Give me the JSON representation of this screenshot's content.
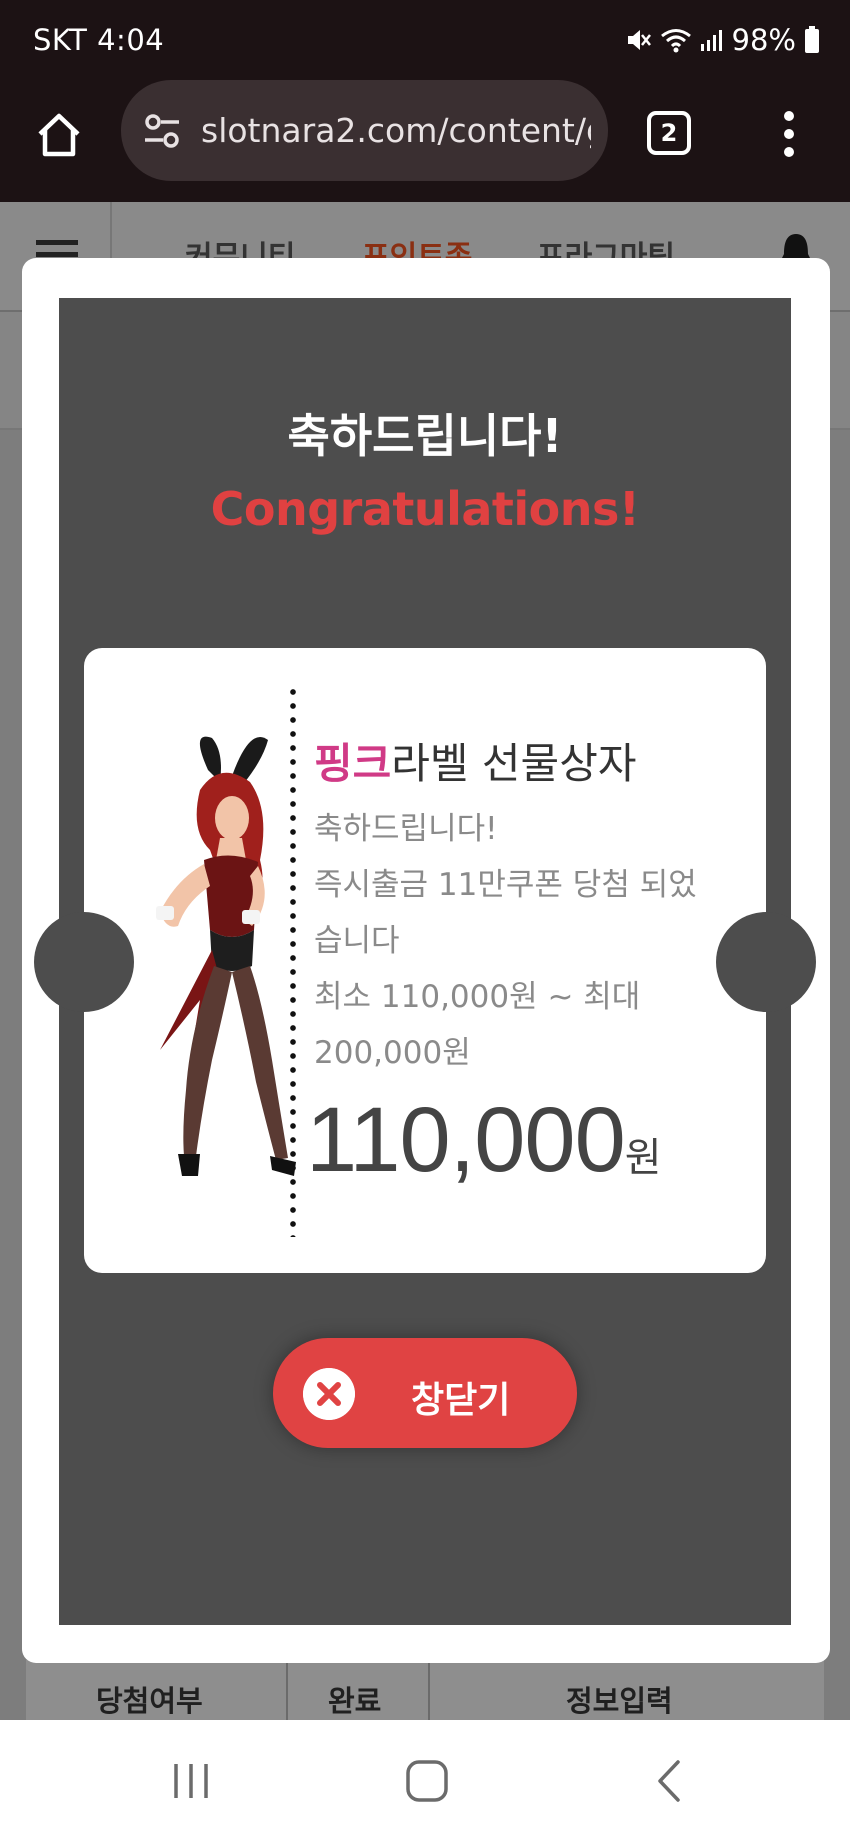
{
  "status_bar": {
    "carrier_time": "SKT 4:04",
    "battery": "98%"
  },
  "browser": {
    "url": "slotnara2.com/content/g",
    "tab_count": "2"
  },
  "page_background": {
    "nav_items": [
      "커뮤니티",
      "포인트존",
      "프라그마틱"
    ],
    "table_headers": [
      "당첨여부",
      "완료",
      "정보입력"
    ]
  },
  "modal": {
    "title": "축하드립니다!",
    "subtitle": "Congratulations!",
    "ticket": {
      "title_accent": "핑크",
      "title_rest": "라벨 선물상자",
      "lines": [
        "축하드립니다!",
        "즉시출금 11만쿠폰 당첨 되었",
        "습니다",
        "최소 110,000원 ~ 최대",
        "200,000원"
      ],
      "amount": "110,000",
      "amount_unit": "원"
    },
    "close_label": "창닫기"
  },
  "colors": {
    "status_bg": "#1c1214",
    "modal_bg": "#4d4d4d",
    "accent_red": "#e04141",
    "accent_pink": "#d03a86"
  },
  "icons": [
    "home-icon",
    "site-settings-icon",
    "tabs-icon",
    "more-menu-icon",
    "mute-icon",
    "wifi-icon",
    "signal-icon",
    "battery-icon",
    "close-x-icon",
    "recent-apps-icon",
    "home-nav-icon",
    "back-icon"
  ]
}
